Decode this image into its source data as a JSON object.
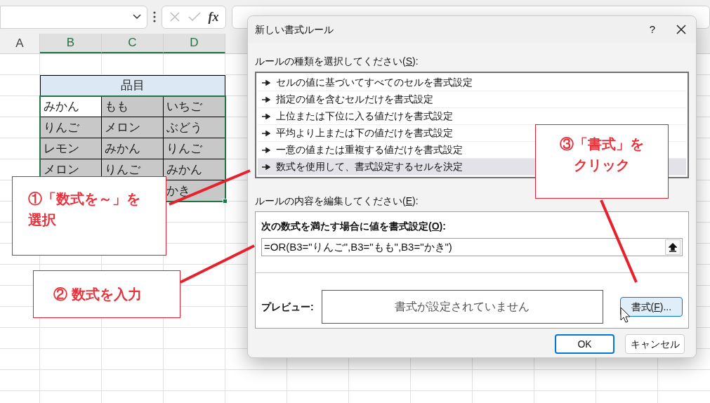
{
  "formula_bar": {
    "fx": "fx"
  },
  "columns": [
    {
      "label": "A",
      "selected": false
    },
    {
      "label": "B",
      "selected": true
    },
    {
      "label": "C",
      "selected": true
    },
    {
      "label": "D",
      "selected": true
    }
  ],
  "table": {
    "header": "品目",
    "rows": [
      [
        {
          "text": "みかん",
          "shaded": false
        },
        {
          "text": "もも",
          "shaded": true
        },
        {
          "text": "いちご",
          "shaded": true
        }
      ],
      [
        {
          "text": "りんご",
          "shaded": true
        },
        {
          "text": "メロン",
          "shaded": true
        },
        {
          "text": "ぶどう",
          "shaded": true
        }
      ],
      [
        {
          "text": "レモン",
          "shaded": true
        },
        {
          "text": "みかん",
          "shaded": true
        },
        {
          "text": "りんご",
          "shaded": true
        }
      ],
      [
        {
          "text": "メロン",
          "shaded": true
        },
        {
          "text": "りんご",
          "shaded": true
        },
        {
          "text": "みかん",
          "shaded": true
        }
      ],
      [
        {
          "text": ""
        },
        {
          "text": ""
        },
        {
          "text": "かき",
          "shaded": true
        }
      ]
    ]
  },
  "dialog": {
    "title": "新しい書式ルール",
    "help": "?",
    "rule_type_label": {
      "before": "ルールの種類を選択してください(",
      "key": "S",
      "after": "):"
    },
    "rule_types": [
      {
        "label": "セルの値に基づいてすべてのセルを書式設定",
        "selected": false
      },
      {
        "label": "指定の値を含むセルだけを書式設定",
        "selected": false
      },
      {
        "label": "上位または下位に入る値だけを書式設定",
        "selected": false
      },
      {
        "label": "平均より上または下の値だけを書式設定",
        "selected": false
      },
      {
        "label": "一意の値または重複する値だけを書式設定",
        "selected": false
      },
      {
        "label": "数式を使用して、書式設定するセルを決定",
        "selected": true
      }
    ],
    "edit_label": {
      "before": "ルールの内容を編集してください(",
      "key": "E",
      "after": "):"
    },
    "formula_label": {
      "before": "次の数式を満たす場合に値を書式設定(",
      "key": "O",
      "after": "):"
    },
    "formula": "=OR(B3=\"りんご\",B3=\"もも\",B3=\"かき\")",
    "preview_label": "プレビュー:",
    "preview_text": "書式が設定されていません",
    "format_button": {
      "before": "書式(",
      "key": "F",
      "after": ")..."
    },
    "ok": "OK",
    "cancel": "キャンセル"
  },
  "callouts": [
    {
      "lines": [
        "①「数式を～」を",
        "選択"
      ]
    },
    {
      "lines": [
        "② 数式を入力"
      ]
    },
    {
      "lines": [
        "③「書式」を",
        "クリック"
      ]
    }
  ]
}
